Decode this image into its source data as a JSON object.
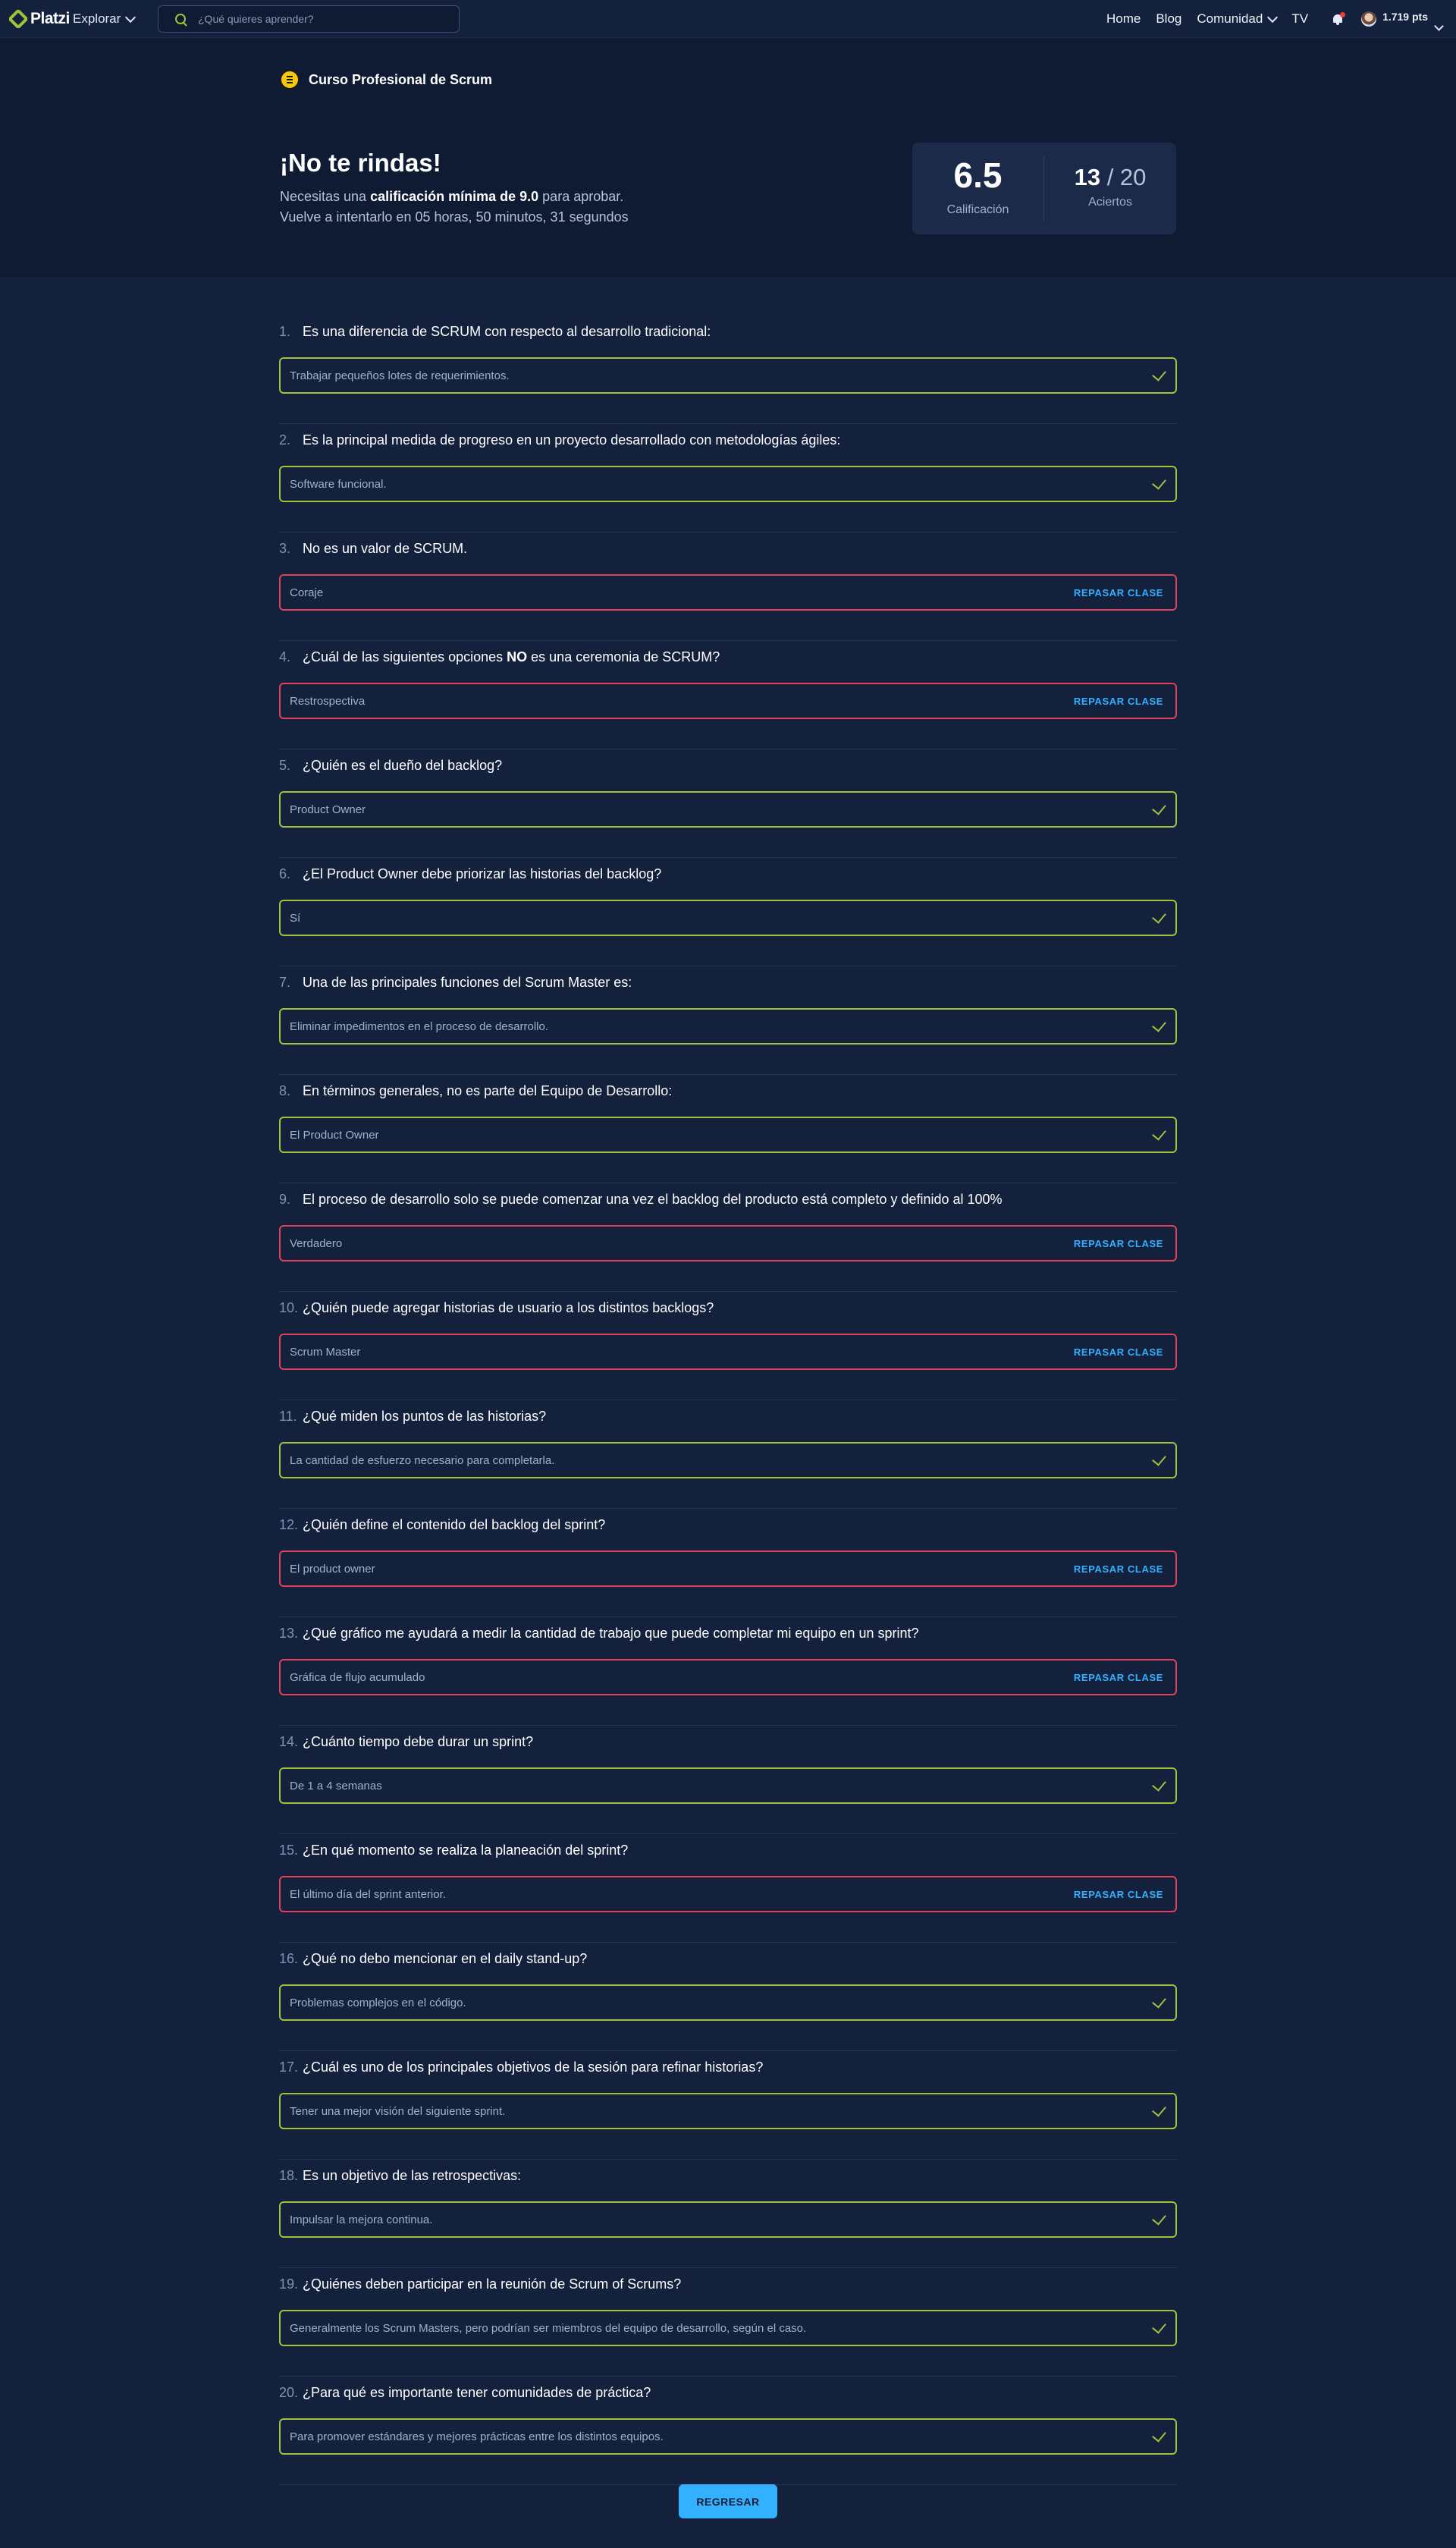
{
  "nav": {
    "brand": "Platzi",
    "explore_label": "Explorar",
    "search_placeholder": "¿Qué quieres aprender?",
    "links": [
      "Home",
      "Blog",
      "Comunidad",
      "TV"
    ],
    "points": "1.719 pts"
  },
  "course": {
    "title": "Curso Profesional de Scrum"
  },
  "result": {
    "title": "¡No te rindas!",
    "line1_prefix": "Necesitas una ",
    "line1_bold": "calificación mínima de 9.0",
    "line1_suffix": " para aprobar.",
    "line2": "Vuelve a intentarlo en 05 horas, 50 minutos, 31 segundos",
    "grade": "6.5",
    "grade_label": "Calificación",
    "correct": "13",
    "separator": " / ",
    "total": "20",
    "hits_label": "Aciertos"
  },
  "review_label": "REPASAR CLASE",
  "questions": [
    {
      "number": "1.",
      "text": "Es una diferencia de SCRUM con respecto al desarrollo tradicional:",
      "answer": "Trabajar pequeños lotes de requerimientos.",
      "correct": true
    },
    {
      "number": "2.",
      "text": "Es la principal medida de progreso en un proyecto desarrollado con metodologías ágiles:",
      "answer": "Software funcional.",
      "correct": true
    },
    {
      "number": "3.",
      "text": "No es un valor de SCRUM.",
      "answer": "Coraje",
      "correct": false
    },
    {
      "number": "4.",
      "text_before": "¿Cuál de las siguientes opciones ",
      "text_bold": "NO",
      "text_after": " es una ceremonia de SCRUM?",
      "answer": "Restrospectiva",
      "correct": false
    },
    {
      "number": "5.",
      "text": "¿Quién es el dueño del backlog?",
      "answer": "Product Owner",
      "correct": true
    },
    {
      "number": "6.",
      "text": "¿El Product Owner debe priorizar las historias del backlog?",
      "answer": "Sí",
      "correct": true
    },
    {
      "number": "7.",
      "text": "Una de las principales funciones del Scrum Master es:",
      "answer": "Eliminar impedimentos en el proceso de desarrollo.",
      "correct": true
    },
    {
      "number": "8.",
      "text": "En términos generales, no es parte del Equipo de Desarrollo:",
      "answer": "El Product Owner",
      "correct": true
    },
    {
      "number": "9.",
      "text": "El proceso de desarrollo solo se puede comenzar una vez el backlog del producto está completo y definido al 100%",
      "answer": "Verdadero",
      "correct": false
    },
    {
      "number": "10.",
      "text": "¿Quién puede agregar historias de usuario a los distintos backlogs?",
      "answer": "Scrum Master",
      "correct": false
    },
    {
      "number": "11.",
      "text": "¿Qué miden los puntos de las historias?",
      "answer": "La cantidad de esfuerzo necesario para completarla.",
      "correct": true
    },
    {
      "number": "12.",
      "text": "¿Quién define el contenido del backlog del sprint?",
      "answer": "El product owner",
      "correct": false
    },
    {
      "number": "13.",
      "text": "¿Qué gráfico me ayudará a medir la cantidad de trabajo que puede completar mi equipo en un sprint?",
      "answer": "Gráfica de flujo acumulado",
      "correct": false
    },
    {
      "number": "14.",
      "text": "¿Cuánto tiempo debe durar un sprint?",
      "answer": "De 1 a 4 semanas",
      "correct": true
    },
    {
      "number": "15.",
      "text": "¿En qué momento se realiza la planeación del sprint?",
      "answer": "El último día del sprint anterior.",
      "correct": false
    },
    {
      "number": "16.",
      "text": "¿Qué no debo mencionar en el daily stand-up?",
      "answer": "Problemas complejos en el código.",
      "correct": true
    },
    {
      "number": "17.",
      "text": "¿Cuál es uno de los principales objetivos de la sesión para refinar historias?",
      "answer": "Tener una mejor visión del siguiente sprint.",
      "correct": true
    },
    {
      "number": "18.",
      "text": "Es un objetivo de las retrospectivas:",
      "answer": "Impulsar la mejora continua.",
      "correct": true
    },
    {
      "number": "19.",
      "text": "¿Quiénes deben participar en la reunión de Scrum of Scrums?",
      "answer": "Generalmente los Scrum Masters, pero podrían ser miembros del equipo de desarrollo, según el caso.",
      "correct": true
    },
    {
      "number": "20.",
      "text": "¿Para qué es importante tener comunidades de práctica?",
      "answer": "Para promover estándares y mejores prácticas entre los distintos equipos.",
      "correct": true
    }
  ],
  "back_button": "REGRESAR",
  "colors": {
    "background": "#13213d",
    "header_bg": "#0f1a33",
    "correct_border": "#9fc33b",
    "wrong_border": "#e0405a",
    "accent_blue": "#33b1ff"
  }
}
